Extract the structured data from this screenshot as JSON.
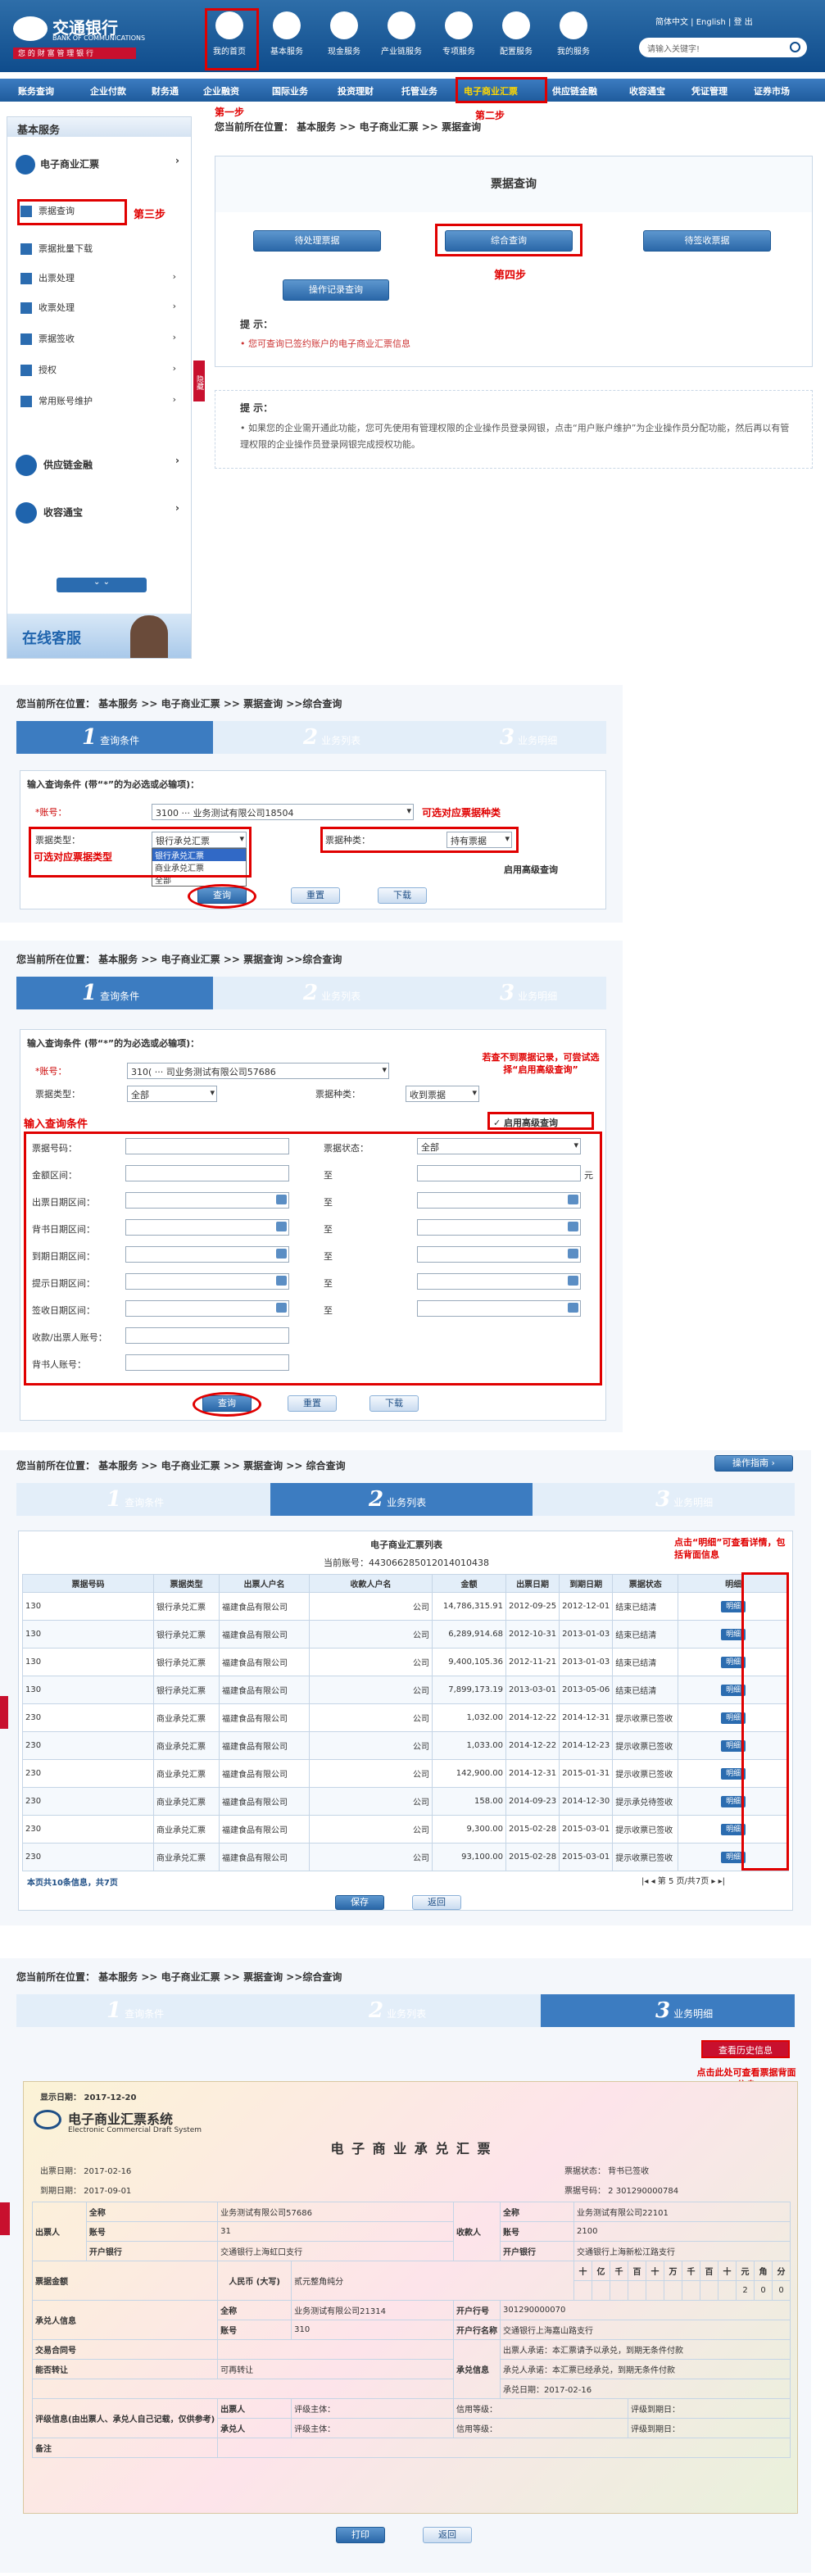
{
  "header": {
    "logo_cn": "交通银行",
    "logo_en": "BANK OF COMMUNICATIONS",
    "slogan": "您 的 财 富 管 理 银 行",
    "top_links": [
      "简体中文",
      "English",
      "登 出"
    ],
    "search_placeholder": "请输入关键字!",
    "icons": [
      {
        "label": "我的首页",
        "icon": "home-icon"
      },
      {
        "label": "基本服务",
        "icon": "monitor-icon"
      },
      {
        "label": "现金服务",
        "icon": "swirl-icon"
      },
      {
        "label": "产业链服务",
        "icon": "chain-icon"
      },
      {
        "label": "专项服务",
        "icon": "tools-icon"
      },
      {
        "label": "配置服务",
        "icon": "gear-icon"
      },
      {
        "label": "我的服务",
        "icon": "user-icon"
      }
    ],
    "nav": [
      "账务查询",
      "企业付款",
      "财务通",
      "企业融资",
      "国际业务",
      "投资理财",
      "托管业务",
      "电子商业汇票",
      "供应链金融",
      "收容通宝",
      "凭证管理",
      "证券市场"
    ]
  },
  "annotations": {
    "step1": "第一步",
    "step2": "第二步",
    "step3": "第三步",
    "step4": "第四步",
    "types": "可选对应票据类型",
    "kinds": "可选对应票据种类",
    "adv_hint": "若查不到票据记录，可尝试选择“启用高级查询”",
    "input_cond": "输入查询条件",
    "detail_hint": "点击“明细”可查看详情，包括背面信息",
    "history_hint": "点击此处可查看票据背面信息"
  },
  "s1": {
    "sidebar_title": "基本服务",
    "menu": [
      "电子商业汇票",
      "票据查询",
      "票据批量下载",
      "出票处理",
      "收票处理",
      "票据签收",
      "授权",
      "常用账号维护"
    ],
    "menu2": [
      "供应链金融",
      "收容通宝"
    ],
    "online": "在线客服",
    "collapse": "隐藏",
    "breadcrumb": "您当前所在位置： 基本服务 >> 电子商业汇票 >> 票据查询",
    "panel_title": "票据查询",
    "buttons": [
      "待处理票据",
      "综合查询",
      "待签收票据",
      "操作记录查询"
    ],
    "tip_title": "提 示：",
    "tip_text": "您可查询已签约账户的电子商业汇票信息",
    "notice_title": "提 示：",
    "notice_text": "如果您的企业需开通此功能，您可先使用有管理权限的企业操作员登录网银，点击“用户账户维护”为企业操作员分配功能，然后再以有管理权限的企业操作员登录网银完成授权功能。"
  },
  "s2": {
    "breadcrumb": "您当前所在位置： 基本服务 >> 电子商业汇票 >> 票据查询 >>综合查询",
    "steps": [
      "查询条件",
      "业务列表",
      "业务明细"
    ],
    "cond_title": "输入查询条件 (带“*”的为必选或必输项)：",
    "account_label": "*账号：",
    "account_value": "3100",
    "account_suffix": "业务测试有限公司18504",
    "type_label": "票据类型：",
    "type_value": "银行承兑汇票",
    "type_options": [
      "银行承兑汇票",
      "商业承兑汇票",
      "全部"
    ],
    "kind_label": "票据种类：",
    "kind_value": "持有票据",
    "adv": "启用高级查询",
    "btn_query": "查询",
    "btn_reset": "重置",
    "btn_download": "下载"
  },
  "s3": {
    "breadcrumb": "您当前所在位置： 基本服务 >> 电子商业汇票 >> 票据查询 >>综合查询",
    "cond_title": "输入查询条件 (带“*”的为必选或必输项)：",
    "account_label": "*账号：",
    "account_value": "310(",
    "account_suffix": "司业务测试有限公司57686",
    "type_label": "票据类型：",
    "type_value": "全部",
    "kind_label": "票据种类：",
    "kind_value": "收到票据",
    "adv": "启用高级查询",
    "fields_left": [
      "票据号码：",
      "金额区间：",
      "出票日期区间：",
      "背书日期区间：",
      "到期日期区间：",
      "提示日期区间：",
      "签收日期区间：",
      "收款/出票人账号：",
      "背书人账号："
    ],
    "status_label": "票据状态：",
    "status_value": "全部",
    "to": "至",
    "yuan": "元"
  },
  "s4": {
    "breadcrumb": "您当前所在位置： 基本服务 >> 电子商业汇票 >> 票据查询 >> 综合查询",
    "guide": "操作指南",
    "list_title": "电子商业汇票列表",
    "account_line": "当前账号：443066285012014010438",
    "headers": [
      "票据号码",
      "票据类型",
      "出票人户名",
      "收款人户名",
      "金额",
      "出票日期",
      "到期日期",
      "票据状态",
      "明细"
    ],
    "rows": [
      [
        "130",
        "银行承兑汇票",
        "福建食品有限公司",
        "公司",
        "14,786,315.91",
        "2012-09-25",
        "2012-12-01",
        "结束已结清"
      ],
      [
        "130",
        "银行承兑汇票",
        "福建食品有限公司",
        "公司",
        "6,289,914.68",
        "2012-10-31",
        "2013-01-03",
        "结束已结清"
      ],
      [
        "130",
        "银行承兑汇票",
        "福建食品有限公司",
        "公司",
        "9,400,105.36",
        "2012-11-21",
        "2013-01-03",
        "结束已结清"
      ],
      [
        "130",
        "银行承兑汇票",
        "福建食品有限公司",
        "公司",
        "7,899,173.19",
        "2013-03-01",
        "2013-05-06",
        "结束已结清"
      ],
      [
        "230",
        "商业承兑汇票",
        "福建食品有限公司",
        "公司",
        "1,032.00",
        "2014-12-22",
        "2014-12-31",
        "提示收票已签收"
      ],
      [
        "230",
        "商业承兑汇票",
        "福建食品有限公司",
        "公司",
        "1,033.00",
        "2014-12-22",
        "2014-12-23",
        "提示收票已签收"
      ],
      [
        "230",
        "商业承兑汇票",
        "福建食品有限公司",
        "公司",
        "142,900.00",
        "2014-12-31",
        "2015-01-31",
        "提示收票已签收"
      ],
      [
        "230",
        "商业承兑汇票",
        "福建食品有限公司",
        "公司",
        "158.00",
        "2014-09-23",
        "2014-12-30",
        "提示承兑待签收"
      ],
      [
        "230",
        "商业承兑汇票",
        "福建食品有限公司",
        "公司",
        "9,300.00",
        "2015-02-28",
        "2015-03-01",
        "提示收票已签收"
      ],
      [
        "230",
        "商业承兑汇票",
        "福建食品有限公司",
        "公司",
        "93,100.00",
        "2015-02-28",
        "2015-03-01",
        "提示收票已签收"
      ]
    ],
    "detail": "明细",
    "pager_left": "本页共10条信息，共7页",
    "pager_right": "第 5 页/共7页",
    "btn_save": "保存",
    "btn_back": "返回"
  },
  "s5": {
    "breadcrumb": "您当前所在位置： 基本服务 >> 电子商业汇票 >> 票据查询 >>综合查询",
    "history_btn": "查看历史信息",
    "show_date": "显示日期： 2017-12-20",
    "ecds_cn": "电子商业汇票系统",
    "ecds_en": "Electronic Commercial Draft System",
    "title": "电 子 商 业 承 兑 汇 票",
    "issue_date": "出票日期： 2017-02-16",
    "due_date": "到期日期： 2017-09-01",
    "status": "票据状态： 背书已签收",
    "bill_no": "票据号码： 2 301290000784",
    "payer": {
      "name": "业务测试有限公司57686",
      "account": "31",
      "bank": "交通银行上海虹口支行"
    },
    "payee": {
      "name": "业务测试有限公司22101",
      "account": "2100",
      "bank": "交通银行上海新松江路支行"
    },
    "amount_cap": "人民币 (大写)",
    "amount_text": "贰元整角纯分",
    "digits": [
      "十",
      "亿",
      "千",
      "百",
      "十",
      "万",
      "千",
      "百",
      "十",
      "元",
      "角",
      "分"
    ],
    "amount_digits": [
      "",
      "",
      "",
      "",
      "",
      "",
      "",
      "",
      "",
      "2",
      "0",
      "0"
    ],
    "acceptor_label": "承兑人信息",
    "acceptor": {
      "name": "业务测试有限公司21314",
      "account": "310",
      "bank_label": "开户行号",
      "bank_no": "301290000070",
      "bank_name": "交通银行上海嘉山路支行"
    },
    "labels": {
      "name": "全称",
      "account": "账号",
      "bank": "开户银行",
      "payer": "出票人",
      "payee": "收款人",
      "amount": "票据金额",
      "trade": "交易合同号",
      "transfer": "能否转让",
      "transfer_val": "可再转让",
      "accept_info": "承兑信息",
      "promise1": "出票人承诺：本汇票请予以承兑，到期无条件付款",
      "promise2": "承兑人承诺：本汇票已经承兑，到期无条件付款",
      "accept_date": "承兑日期：2017-02-16",
      "credit": "评级信息(由出票人、承兑人自己记载，仅供参考)",
      "credit_payer": "出票人",
      "credit_acc": "承兑人",
      "rater": "评级主体：",
      "level": "信用等级：",
      "expiry": "评级到期日：",
      "remark": "备注",
      "bank_no_label": "开户行号",
      "bank_name_label": "开户行名称"
    },
    "btn_print": "打印",
    "btn_back": "返回"
  }
}
